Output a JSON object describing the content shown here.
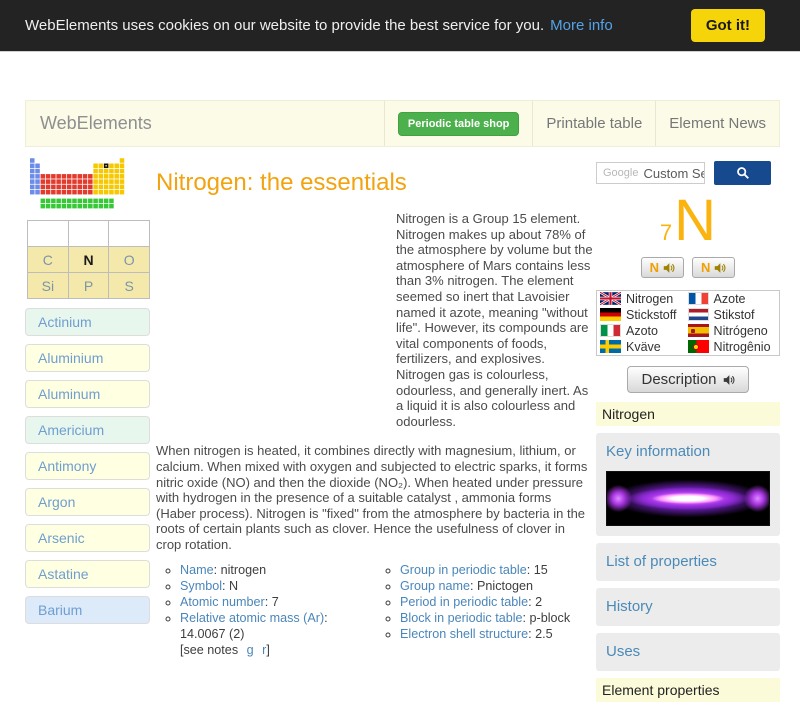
{
  "cookie": {
    "message": "WebElements uses cookies on our website to provide the best service for you.",
    "more_info": "More info",
    "accept": "Got it!",
    "bg": "#232323",
    "accept_color": "#f6d40a"
  },
  "header": {
    "brand": "WebElements",
    "shop_label": "Periodic table shop",
    "shop_color": "#4cb04c",
    "nav": [
      "Printable table",
      "Element News"
    ],
    "bg": "#fbfbe7"
  },
  "sidebar": {
    "neighbors": [
      [
        "",
        "",
        ""
      ],
      [
        "C",
        "N",
        "O"
      ],
      [
        "Si",
        "P",
        "S"
      ]
    ],
    "current_element": "N",
    "elements": [
      {
        "label": "Actinium",
        "bg": "#e7f7ee"
      },
      {
        "label": "Aluminium",
        "bg": "#ffffe1"
      },
      {
        "label": "Aluminum",
        "bg": "#ffffe1"
      },
      {
        "label": "Americium",
        "bg": "#e7f7ee"
      },
      {
        "label": "Antimony",
        "bg": "#ffffe1"
      },
      {
        "label": "Argon",
        "bg": "#ffffe1"
      },
      {
        "label": "Arsenic",
        "bg": "#ffffe1"
      },
      {
        "label": "Astatine",
        "bg": "#ffffe1"
      },
      {
        "label": "Barium",
        "bg": "#dceafa"
      }
    ]
  },
  "main": {
    "title": "Nitrogen: the essentials",
    "title_color": "#f2a30f",
    "intro": "Nitrogen is a Group 15 element. Nitrogen makes up about 78% of the atmosphere by volume but the atmosphere of Mars contains less than 3% nitrogen. The element seemed so inert that Lavoisier named it azote, meaning \"without life\". However, its compounds are vital components of foods, fertilizers, and explosives. Nitrogen gas is colourless, odourless, and generally inert. As a liquid it is also colourless and odourless.",
    "para2": "When nitrogen is heated, it combines directly with magnesium, lithium, or calcium. When mixed with oxygen and subjected to electric sparks, it forms nitric oxide (NO) and then the dioxide (NO₂). When heated under pressure with hydrogen in the presence of a suitable catalyst , ammonia forms (Haber process). Nitrogen is \"fixed\" from the atmosphere by bacteria in the roots of certain plants such as clover. Hence the usefulness of clover in crop rotation.",
    "sep": ": ",
    "facts_left": [
      {
        "label": "Name",
        "value": "nitrogen"
      },
      {
        "label": "Symbol",
        "value": "N"
      },
      {
        "label": "Atomic number",
        "value": "7"
      },
      {
        "label": "Relative atomic mass (Ar)",
        "value": "14.0067 (2)"
      }
    ],
    "notes_prefix": "[see notes",
    "note_g": "g",
    "note_r": "r",
    "notes_suffix": "]",
    "facts_right": [
      {
        "label": "Group in periodic table",
        "value": "15"
      },
      {
        "label": "Group name",
        "value": "Pnictogen"
      },
      {
        "label": "Period in periodic table",
        "value": "2"
      },
      {
        "label": "Block in periodic table",
        "value": "p-block"
      },
      {
        "label": "Electron shell structure",
        "value": "2.5"
      }
    ]
  },
  "aside": {
    "search": {
      "watermark": "Google",
      "placeholder": "Custom Se",
      "button_color": "#17498f"
    },
    "element": {
      "atomic_number": "7",
      "symbol": "N",
      "color": "#fbb40f"
    },
    "audio_buttons": [
      "N",
      "N"
    ],
    "languages": [
      {
        "flag": "uk",
        "label": "Nitrogen"
      },
      {
        "flag": "france",
        "label": "Azote"
      },
      {
        "flag": "germany",
        "label": "Stickstoff"
      },
      {
        "flag": "netherlands",
        "label": "Stikstof"
      },
      {
        "flag": "italy",
        "label": "Azoto"
      },
      {
        "flag": "spain",
        "label": "Nitrógeno"
      },
      {
        "flag": "sweden",
        "label": "Kväve"
      },
      {
        "flag": "portugal",
        "label": "Nitrogênio"
      }
    ],
    "description_label": "Description",
    "section_nitrogen": "Nitrogen",
    "links": [
      "Key information",
      "List of properties",
      "History",
      "Uses"
    ],
    "section_properties": "Element properties"
  }
}
